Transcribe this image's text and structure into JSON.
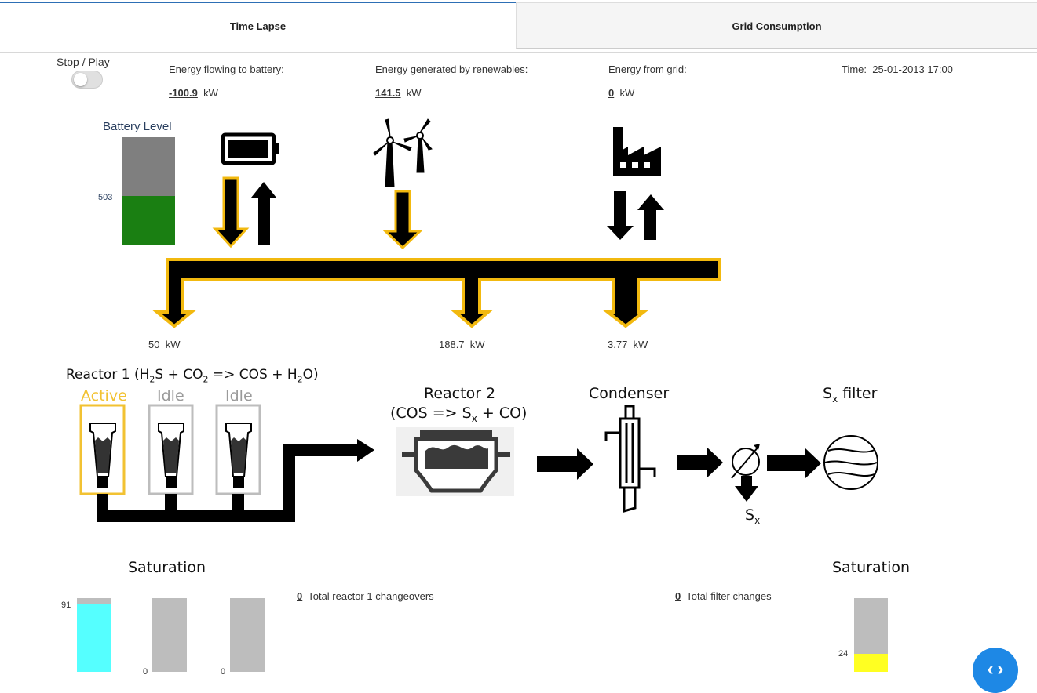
{
  "tabs": [
    {
      "label": "Time Lapse",
      "active": true
    },
    {
      "label": "Grid Consumption",
      "active": false
    }
  ],
  "controls": {
    "stop_play_label": "Stop / Play",
    "playing": false
  },
  "energy": {
    "battery_label": "Energy flowing to battery:",
    "battery_value": "-100.9",
    "renewables_label": "Energy generated by renewables:",
    "renewables_value": "141.5",
    "grid_label": "Energy from grid:",
    "grid_value": "0",
    "unit": "kW"
  },
  "time": {
    "label": "Time:",
    "value": "25-01-2013 17:00"
  },
  "battery": {
    "label": "Battery Level",
    "value": "503",
    "fill_fraction": 0.45,
    "fill_color": "#1a7f12",
    "empty_color": "#7f7f7f"
  },
  "consumers": [
    {
      "value": "50",
      "unit": "kW"
    },
    {
      "value": "188.7",
      "unit": "kW"
    },
    {
      "value": "3.77",
      "unit": "kW"
    }
  ],
  "reactor1": {
    "title_parts": [
      "Reactor 1 (H",
      "2",
      "S + CO",
      "2",
      " => COS + H",
      "2",
      "O)"
    ],
    "units": [
      {
        "status": "Active",
        "color": "#f2c232"
      },
      {
        "status": "Idle",
        "color": "#b5b5b5"
      },
      {
        "status": "Idle",
        "color": "#b5b5b5"
      }
    ]
  },
  "reactor2": {
    "line1": "Reactor 2",
    "line2_parts": [
      "(COS => S",
      "x",
      " + CO)"
    ]
  },
  "condenser": {
    "label": "Condenser"
  },
  "filter": {
    "label_main": "S",
    "label_sub": "x",
    "label_rest": " filter"
  },
  "sulfur_out": {
    "main": "S",
    "sub": "x"
  },
  "saturation_left": {
    "title": "Saturation",
    "bars": [
      {
        "value": "91",
        "fraction": 0.91,
        "color": "#55ffff"
      },
      {
        "value": "0",
        "fraction": 0,
        "color": "#55ffff"
      },
      {
        "value": "0",
        "fraction": 0,
        "color": "#55ffff"
      }
    ]
  },
  "saturation_right": {
    "title": "Saturation",
    "value": "24",
    "fraction": 0.24,
    "color": "#ffff22"
  },
  "counters": {
    "reactor_changeovers_value": "0",
    "reactor_changeovers_label": "Total reactor 1 changeovers",
    "filter_changes_value": "0",
    "filter_changes_label": "Total filter changes"
  },
  "fab": {
    "icon": "code-icon"
  }
}
